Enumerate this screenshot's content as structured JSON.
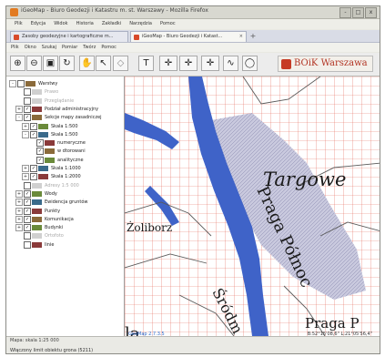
{
  "window": {
    "title": "iGeoMap - Biuro Geodezji i Katastru m. st. Warszawy - Mozilla Firefox",
    "controls": [
      "-",
      "□",
      "x"
    ]
  },
  "browser_menu": [
    "Plik",
    "Edycja",
    "Widok",
    "Historia",
    "Zakładki",
    "Narzędzia",
    "Pomoc"
  ],
  "tabs": [
    {
      "label": "Zasoby geodezyjne i kartograficzne m..."
    },
    {
      "label": "iGeoMap - Biuro Geodezji i Katast..."
    }
  ],
  "app_menu": [
    "Plik",
    "Okno",
    "Szukaj",
    "Pomiar",
    "Twórz",
    "Pomoc"
  ],
  "toolbar": {
    "icons": [
      "zoom-in",
      "zoom-out",
      "zoom-extent",
      "refresh",
      "pan",
      "select",
      "info",
      "text",
      "measure-distance",
      "measure-area",
      "measure-coord",
      "polyline",
      "polygon"
    ],
    "brand_label": "BOiK Warszawa"
  },
  "tree": [
    {
      "label": "Warstwy",
      "exp": "-",
      "check": false,
      "disabled": false,
      "indent": 0
    },
    {
      "label": "Prawo",
      "exp": "",
      "check": false,
      "disabled": true,
      "indent": 1
    },
    {
      "label": "Przeglądanie",
      "exp": "",
      "check": false,
      "disabled": true,
      "indent": 1
    },
    {
      "label": "Podział administracyjny",
      "exp": "+",
      "check": true,
      "disabled": false,
      "indent": 1
    },
    {
      "label": "Sekcje mapy zasadniczej",
      "exp": "-",
      "check": true,
      "disabled": false,
      "indent": 1
    },
    {
      "label": "Skala 1:500",
      "exp": "+",
      "check": true,
      "disabled": false,
      "indent": 2
    },
    {
      "label": "Skala 1:500",
      "exp": "-",
      "check": true,
      "disabled": false,
      "indent": 2
    },
    {
      "label": "numeryczne",
      "exp": "",
      "check": true,
      "disabled": false,
      "indent": 3
    },
    {
      "label": "w dtorowani",
      "exp": "",
      "check": true,
      "disabled": false,
      "indent": 3
    },
    {
      "label": "analityczne",
      "exp": "",
      "check": true,
      "disabled": false,
      "indent": 3
    },
    {
      "label": "Skala 1:1000",
      "exp": "+",
      "check": true,
      "disabled": false,
      "indent": 2
    },
    {
      "label": "Skala 1:2000",
      "exp": "+",
      "check": true,
      "disabled": false,
      "indent": 2
    },
    {
      "label": "Adresy 1:5 000",
      "exp": "",
      "check": false,
      "disabled": true,
      "indent": 1
    },
    {
      "label": "Wody",
      "exp": "+",
      "check": true,
      "disabled": false,
      "indent": 1
    },
    {
      "label": "Ewidencja gruntów",
      "exp": "+",
      "check": true,
      "disabled": false,
      "indent": 1
    },
    {
      "label": "Punkty",
      "exp": "+",
      "check": true,
      "disabled": false,
      "indent": 1
    },
    {
      "label": "Komunikacja",
      "exp": "+",
      "check": true,
      "disabled": false,
      "indent": 1
    },
    {
      "label": "Budynki",
      "exp": "+",
      "check": true,
      "disabled": false,
      "indent": 1
    },
    {
      "label": "Ortofoto",
      "exp": "",
      "check": false,
      "disabled": true,
      "indent": 1
    },
    {
      "label": "linie",
      "exp": "",
      "check": false,
      "disabled": false,
      "indent": 1
    }
  ],
  "map": {
    "labels": {
      "targowek": "Targowe",
      "zoliborz": "Żoliborz",
      "praga_polnoc": "Praga Północ",
      "srodmiescie": "Śródm",
      "praga_p": "Praga P",
      "la": "la"
    },
    "colors": {
      "grid": "#e56a5a",
      "river": "#3f63c8",
      "district": "#5a5a5a",
      "highlight": "#c9c9de"
    }
  },
  "statusbar": {
    "scale_line": "Mapa: skala 1:25 000",
    "brand": "GeoMap 2.7.3.5",
    "coords": "B:52°15'08,6\" L:21°05'56,4\"",
    "status_text": "Włączony limit obiektu grona (5211)"
  }
}
